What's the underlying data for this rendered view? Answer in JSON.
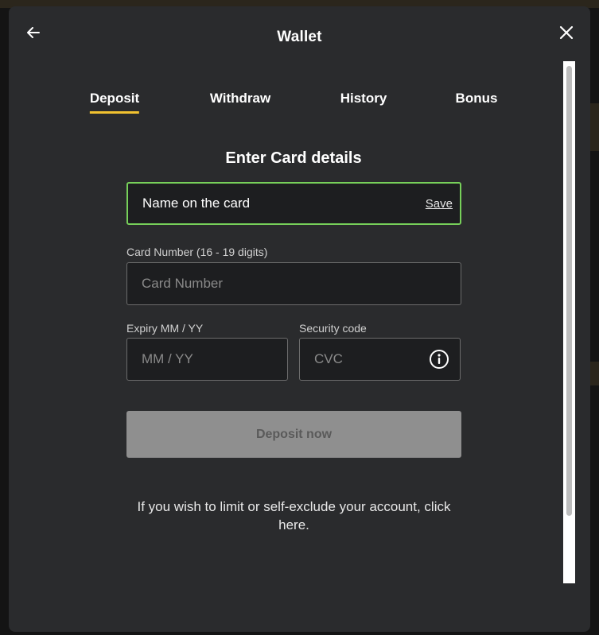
{
  "modal": {
    "title": "Wallet",
    "back_icon": "arrow-left-icon",
    "close_icon": "close-icon"
  },
  "tabs": [
    {
      "label": "Deposit",
      "active": true
    },
    {
      "label": "Withdraw",
      "active": false
    },
    {
      "label": "History",
      "active": false
    },
    {
      "label": "Bonus",
      "active": false
    }
  ],
  "form": {
    "heading": "Enter Card details",
    "name_field": {
      "value": "Name on the card",
      "save_label": "Save"
    },
    "card_number": {
      "label": "Card Number (16 - 19 digits)",
      "placeholder": "Card Number"
    },
    "expiry": {
      "label": "Expiry MM / YY",
      "placeholder": "MM / YY"
    },
    "security": {
      "label": "Security code",
      "placeholder": "CVC",
      "icon": "info-icon"
    },
    "submit_label": "Deposit now"
  },
  "footer": {
    "text": "If you wish to limit or self-exclude your account, click here."
  },
  "colors": {
    "accent_underline": "#f2c230",
    "focus_border": "#77d05a",
    "modal_bg": "#2a2b2d",
    "disabled_button": "#8f8f8f"
  }
}
